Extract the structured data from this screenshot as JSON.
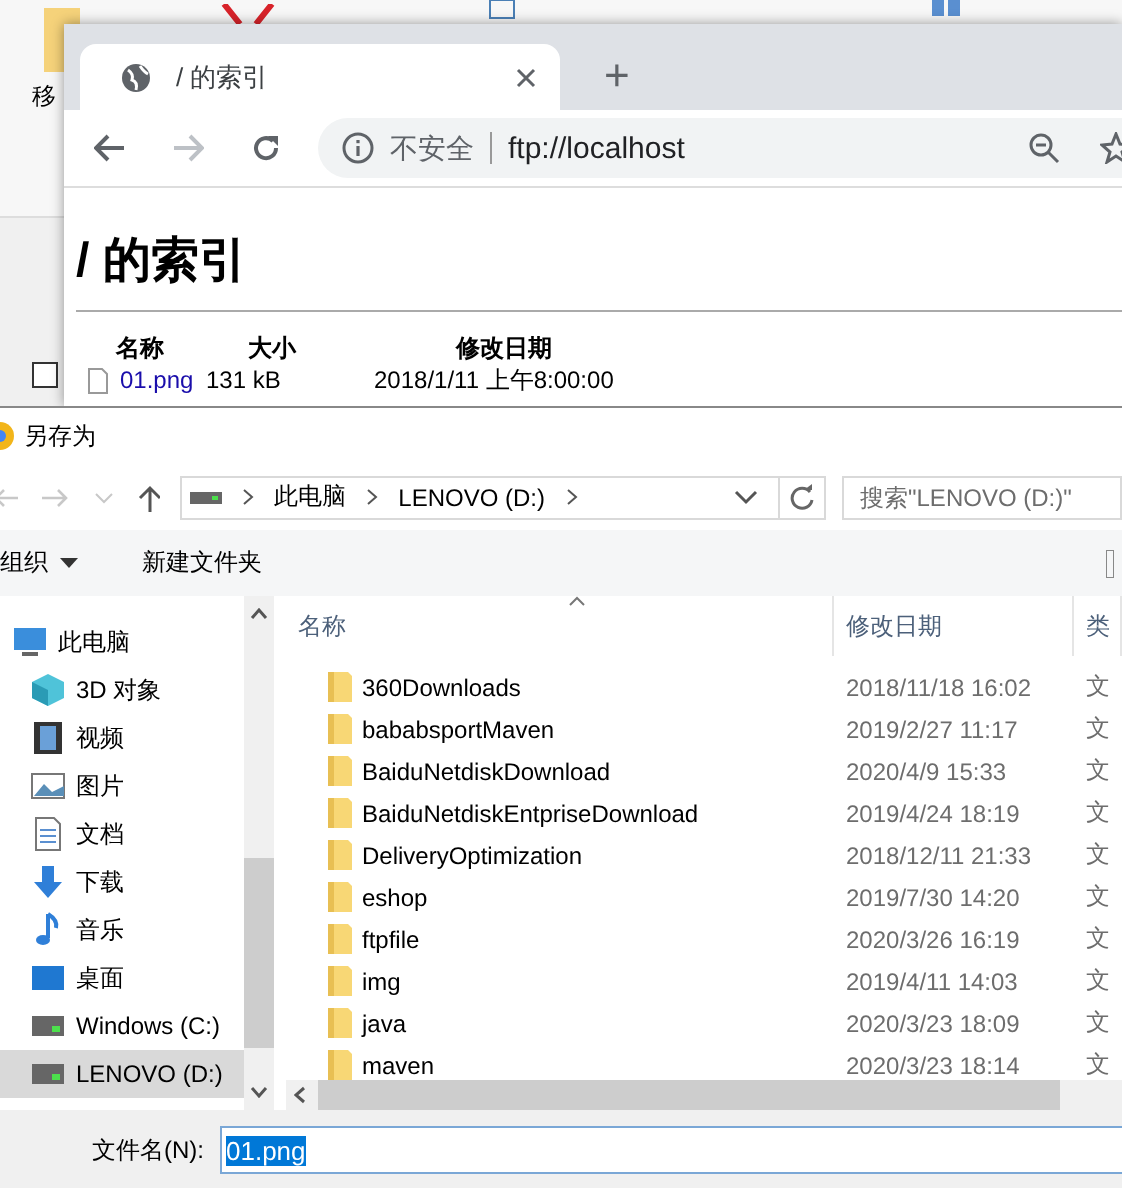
{
  "explorer_ribbon": {
    "label": "移",
    "checkbox": {
      "checked": false
    }
  },
  "browser": {
    "tab": {
      "title": "/ 的索引",
      "selected": true
    },
    "new_tab": "+",
    "omnibox": {
      "security": "不安全",
      "url": "ftp://localhost"
    },
    "page": {
      "heading": "/ 的索引",
      "columns": [
        "名称",
        "大小",
        "修改日期"
      ],
      "files": [
        {
          "name": "01.png",
          "size": "131 kB",
          "modified": "2018/1/11 上午8:00:00"
        }
      ]
    }
  },
  "save_dialog": {
    "title": "另存为",
    "breadcrumb": [
      "此电脑",
      "LENOVO (D:)"
    ],
    "search": {
      "placeholder": "搜索\"LENOVO (D:)\""
    },
    "toolbar": [
      "组织",
      "新建文件夹"
    ],
    "nav": [
      {
        "label": "此电脑",
        "kind": "pc",
        "selected": false,
        "children": [
          {
            "label": "3D 对象",
            "kind": "cube",
            "selected": false
          },
          {
            "label": "视频",
            "kind": "film",
            "selected": false
          },
          {
            "label": "图片",
            "kind": "image",
            "selected": false
          },
          {
            "label": "文档",
            "kind": "doc",
            "selected": false
          },
          {
            "label": "下载",
            "kind": "download",
            "selected": false
          },
          {
            "label": "音乐",
            "kind": "music",
            "selected": false
          },
          {
            "label": "桌面",
            "kind": "desktop",
            "selected": false
          },
          {
            "label": "Windows (C:)",
            "kind": "drive",
            "selected": false
          },
          {
            "label": "LENOVO (D:)",
            "kind": "drive",
            "selected": true
          }
        ]
      }
    ],
    "columns": [
      "名称",
      "修改日期",
      "类"
    ],
    "rows": [
      {
        "name": "360Downloads",
        "modified": "2018/11/18 16:02",
        "type": "文"
      },
      {
        "name": "bababsportMaven",
        "modified": "2019/2/27 11:17",
        "type": "文"
      },
      {
        "name": "BaiduNetdiskDownload",
        "modified": "2020/4/9 15:33",
        "type": "文"
      },
      {
        "name": "BaiduNetdiskEntpriseDownload",
        "modified": "2019/4/24 18:19",
        "type": "文"
      },
      {
        "name": "DeliveryOptimization",
        "modified": "2018/12/11 21:33",
        "type": "文"
      },
      {
        "name": "eshop",
        "modified": "2019/7/30 14:20",
        "type": "文"
      },
      {
        "name": "ftpfile",
        "modified": "2020/3/26 16:19",
        "type": "文"
      },
      {
        "name": "img",
        "modified": "2019/4/11 14:03",
        "type": "文"
      },
      {
        "name": "java",
        "modified": "2020/3/23 18:09",
        "type": "文"
      },
      {
        "name": "maven",
        "modified": "2020/3/23 18:14",
        "type": "文"
      }
    ],
    "filename": {
      "label": "文件名(N):",
      "value": "01.png"
    }
  }
}
